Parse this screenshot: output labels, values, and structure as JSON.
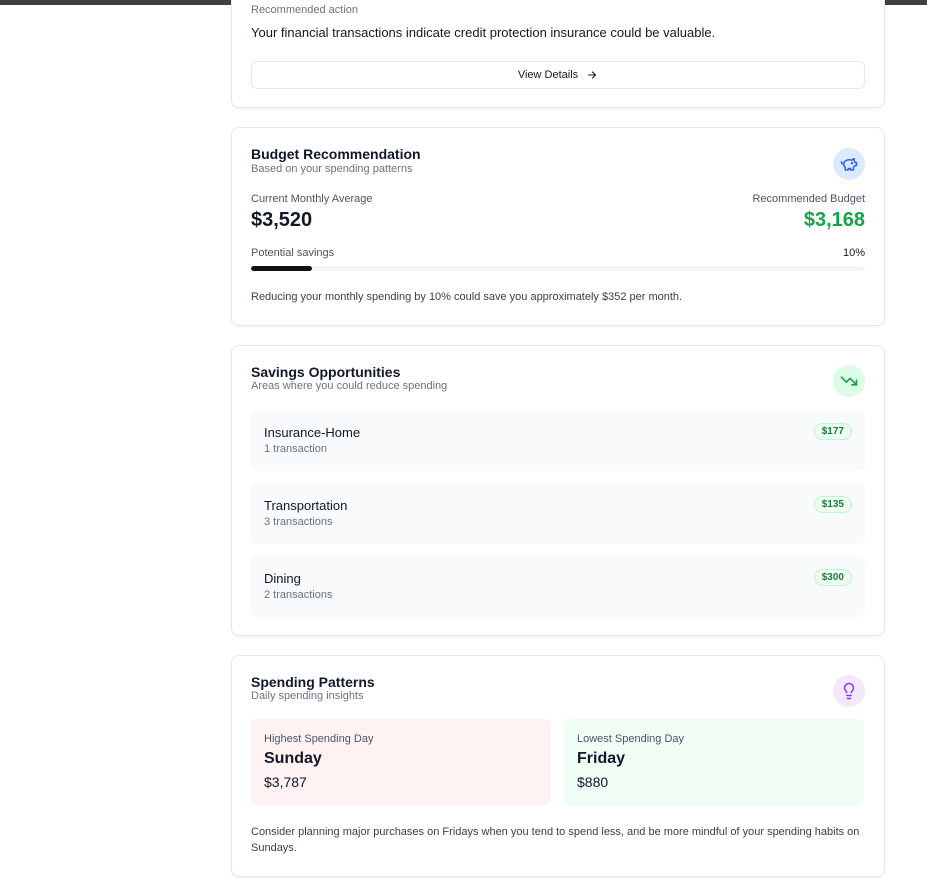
{
  "recommendation": {
    "label": "Recommended action",
    "text": "Your financial transactions indicate credit protection insurance could be valuable.",
    "button_label": "View Details"
  },
  "budget": {
    "title": "Budget Recommendation",
    "subtitle": "Based on your spending patterns",
    "icon": "piggy-bank-icon",
    "current_label": "Current Monthly Average",
    "current_value": "$3,520",
    "recommended_label": "Recommended Budget",
    "recommended_value": "$3,168",
    "savings_label": "Potential savings",
    "savings_percent_text": "10%",
    "savings_fraction": 0.1,
    "note": "Reducing your monthly spending by 10% could save you approximately $352 per month.",
    "colors": {
      "recommended": "#16a34a",
      "icon_bg": "#dbeafe",
      "icon_fg": "#2563eb"
    }
  },
  "savings": {
    "title": "Savings Opportunities",
    "subtitle": "Areas where you could reduce spending",
    "icon": "trending-down-icon",
    "items": [
      {
        "name": "Insurance-Home",
        "count": "1 transaction",
        "amount": "$177"
      },
      {
        "name": "Transportation",
        "count": "3 transactions",
        "amount": "$135"
      },
      {
        "name": "Dining",
        "count": "2 transactions",
        "amount": "$300"
      }
    ],
    "colors": {
      "icon_bg": "#dcfce7",
      "icon_fg": "#16a34a"
    }
  },
  "patterns": {
    "title": "Spending Patterns",
    "subtitle": "Daily spending insights",
    "icon": "lightbulb-icon",
    "highest": {
      "label": "Highest Spending Day",
      "day": "Sunday",
      "amount": "$3,787"
    },
    "lowest": {
      "label": "Lowest Spending Day",
      "day": "Friday",
      "amount": "$880"
    },
    "note": "Consider planning major purchases on Fridays when you tend to spend less, and be more mindful of your spending habits on Sundays.",
    "colors": {
      "icon_bg": "#f3e8ff",
      "icon_fg": "#9333ea",
      "highest_bg": "#fef2f2",
      "lowest_bg": "#f0fdf4"
    }
  }
}
